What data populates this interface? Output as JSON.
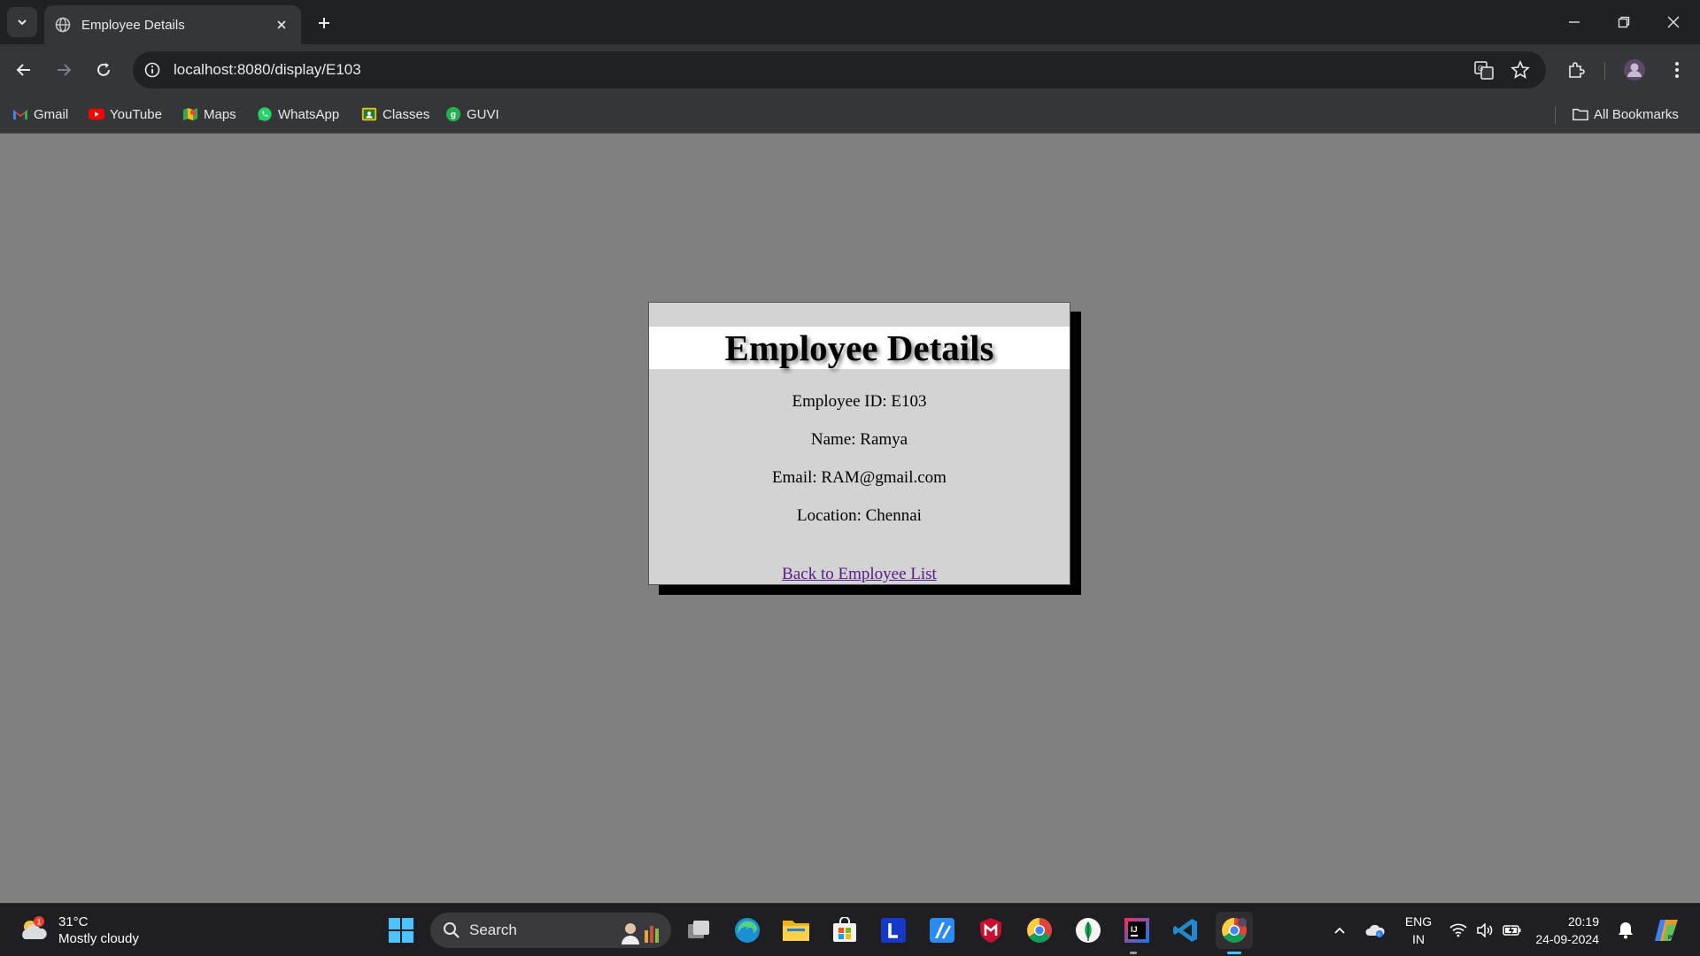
{
  "browser": {
    "tab_title": "Employee Details",
    "url": "localhost:8080/display/E103",
    "bookmarks": [
      {
        "label": "Gmail",
        "icon": "gmail-icon"
      },
      {
        "label": "YouTube",
        "icon": "youtube-icon"
      },
      {
        "label": "Maps",
        "icon": "maps-icon"
      },
      {
        "label": "WhatsApp",
        "icon": "whatsapp-icon"
      },
      {
        "label": "Classes",
        "icon": "classes-icon"
      },
      {
        "label": "GUVI",
        "icon": "guvi-icon"
      }
    ],
    "all_bookmarks_label": "All Bookmarks"
  },
  "page": {
    "heading": "Employee Details",
    "employee_id": "Employee ID: E103",
    "name": "Name: Ramya",
    "email": "Email: RAM@gmail.com",
    "location": "Location: Chennai",
    "back_link": "Back to Employee List"
  },
  "taskbar": {
    "weather_temp": "31°C",
    "weather_desc": "Mostly cloudy",
    "weather_badge": "1",
    "search_label": "Search",
    "lang_line1": "ENG",
    "lang_line2": "IN",
    "time": "20:19",
    "date": "24-09-2024"
  },
  "colors": {
    "page_bg": "#808080",
    "card_bg": "#d3d3d3",
    "link_visited": "#551a8b",
    "chrome_dark": "#202124",
    "chrome_toolbar": "#35363a"
  }
}
